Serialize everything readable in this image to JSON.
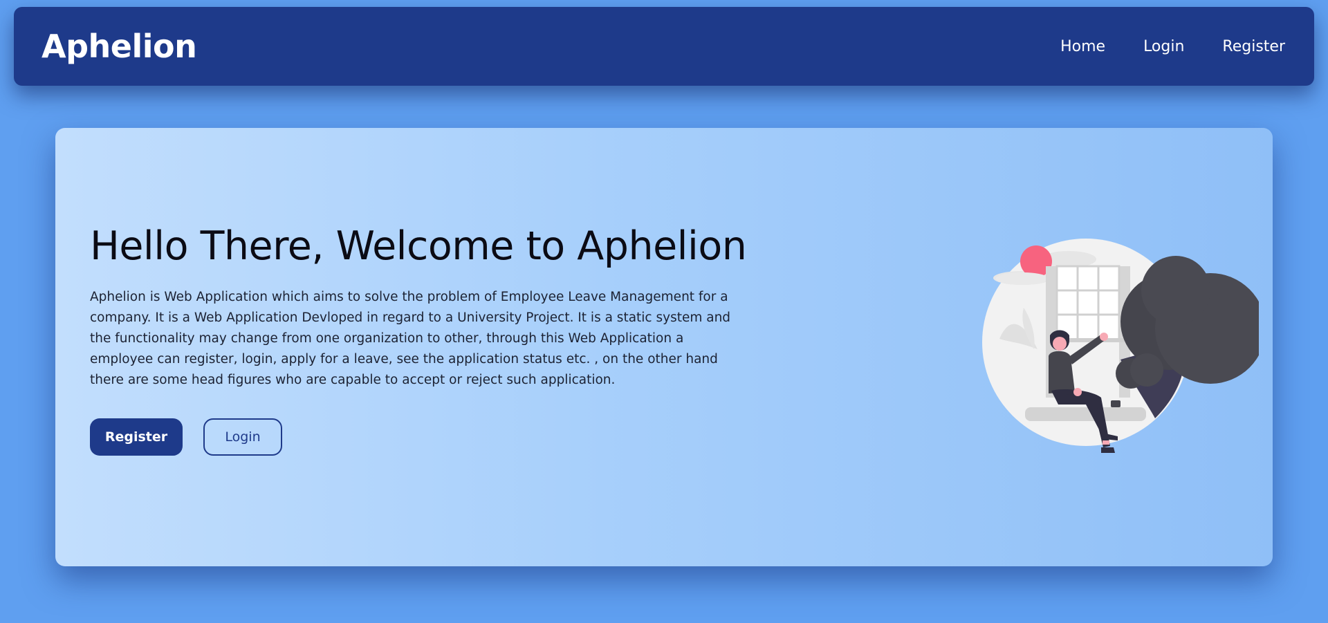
{
  "navbar": {
    "brand": "Aphelion",
    "links": [
      {
        "label": "Home"
      },
      {
        "label": "Login"
      },
      {
        "label": "Register"
      }
    ]
  },
  "hero": {
    "title": "Hello There, Welcome to Aphelion",
    "description": "Aphelion is Web Application which aims to solve the problem of Employee Leave Management for a company. It is a Web Application Devloped in regard to a University Project. It is a static system and the functionality may change from one organization to other, through this Web Application a employee can register, login, apply for a leave, see the application status etc. , on the other hand there are some head figures who are capable to accept or reject such application.",
    "register_label": "Register",
    "login_label": "Login",
    "illustration_icon": "woman-sitting-by-window-illustration"
  },
  "colors": {
    "page_background": "#5f9ff0",
    "navbar": "#1e3a8a",
    "primary_button": "#1e3a8a",
    "sun_accent": "#f7637f",
    "tree": "#45454d"
  }
}
